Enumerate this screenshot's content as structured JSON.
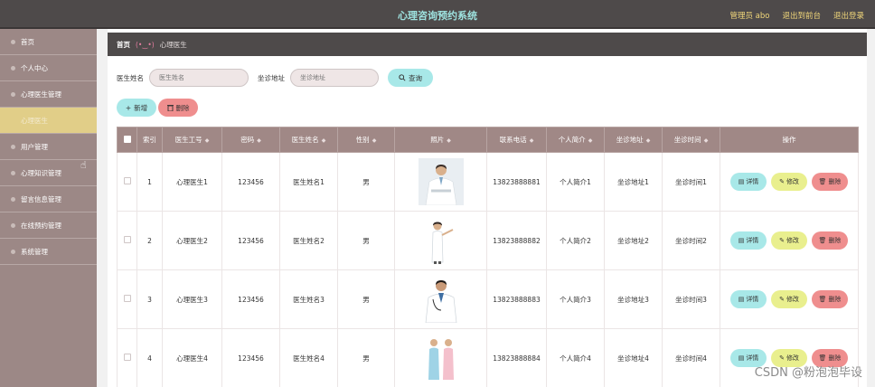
{
  "header": {
    "title": "心理咨询预约系统",
    "admin_label": "管理员 abo",
    "backend_label": "退出到前台",
    "logout_label": "退出登录"
  },
  "sidebar": {
    "items": [
      {
        "label": "首页",
        "active": false
      },
      {
        "label": "个人中心",
        "active": false
      },
      {
        "label": "心理医生管理",
        "active": false
      },
      {
        "label": "心理医生",
        "active": true
      },
      {
        "label": "用户管理",
        "active": false
      },
      {
        "label": "心理知识管理",
        "active": false
      },
      {
        "label": "留言信息管理",
        "active": false
      },
      {
        "label": "在线预约管理",
        "active": false
      },
      {
        "label": "系统管理",
        "active": false
      }
    ]
  },
  "breadcrumb": {
    "home": "首页",
    "face": "(•‿•)",
    "current": "心理医生"
  },
  "search": {
    "name_label": "医生姓名",
    "name_placeholder": "医生姓名",
    "address_label": "坐诊地址",
    "address_placeholder": "坐诊地址",
    "query_label": "查询"
  },
  "toolbar": {
    "add_label": "新增",
    "delete_label": "删除"
  },
  "table": {
    "columns": [
      "索引",
      "医生工号",
      "密码",
      "医生姓名",
      "性别",
      "照片",
      "联系电话",
      "个人简介",
      "坐诊地址",
      "坐诊时间",
      "操作"
    ],
    "rows": [
      {
        "index": "1",
        "id": "心理医生1",
        "password": "123456",
        "name": "医生姓名1",
        "gender": "男",
        "phone": "13823888881",
        "intro": "个人简介1",
        "address": "坐诊地址1",
        "time": "坐诊时间1"
      },
      {
        "index": "2",
        "id": "心理医生2",
        "password": "123456",
        "name": "医生姓名2",
        "gender": "男",
        "phone": "13823888882",
        "intro": "个人简介2",
        "address": "坐诊地址2",
        "time": "坐诊时间2"
      },
      {
        "index": "3",
        "id": "心理医生3",
        "password": "123456",
        "name": "医生姓名3",
        "gender": "男",
        "phone": "13823888883",
        "intro": "个人简介3",
        "address": "坐诊地址3",
        "time": "坐诊时间3"
      },
      {
        "index": "4",
        "id": "心理医生4",
        "password": "123456",
        "name": "医生姓名4",
        "gender": "男",
        "phone": "13823888884",
        "intro": "个人简介4",
        "address": "坐诊地址4",
        "time": "坐诊时间4"
      }
    ],
    "row_actions": {
      "detail": "详情",
      "edit": "修改",
      "remove": "删除"
    }
  },
  "watermark": "CSDN @粉泡泡毕设",
  "colors": {
    "topbar": "#4e4a4a",
    "title": "#9ee3e0",
    "sidebar": "#9c8886",
    "sidebar_active": "#e1ce88",
    "table_header": "#a08886",
    "btn_cyan": "#a8e8e8",
    "btn_yellow": "#e9ef8e",
    "btn_red": "#ef8e8e"
  }
}
